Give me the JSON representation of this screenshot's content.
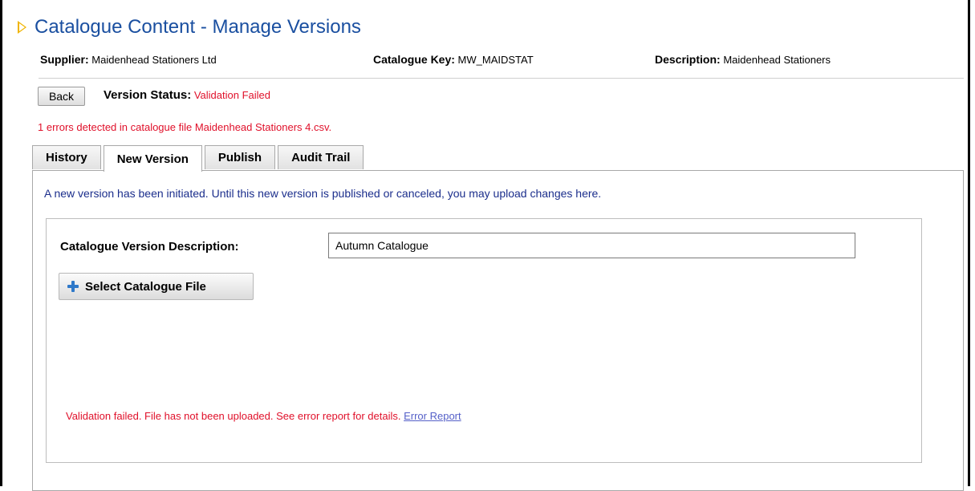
{
  "page": {
    "title": "Catalogue Content - Manage Versions"
  },
  "info": {
    "supplier_label": "Supplier:",
    "supplier_value": "Maidenhead Stationers Ltd",
    "key_label": "Catalogue Key:",
    "key_value": "MW_MAIDSTAT",
    "description_label": "Description:",
    "description_value": "Maidenhead Stationers"
  },
  "actions": {
    "back_label": "Back"
  },
  "status": {
    "label": "Version Status:",
    "value": "Validation Failed",
    "errors_message": "1 errors detected in catalogue file Maidenhead Stationers 4.csv."
  },
  "tabs": [
    {
      "label": "History",
      "active": false
    },
    {
      "label": "New Version",
      "active": true
    },
    {
      "label": "Publish",
      "active": false
    },
    {
      "label": "Audit Trail",
      "active": false
    }
  ],
  "panel": {
    "notice": "A new version has been initiated. Until this new version is published or canceled, you may upload changes here.",
    "version_description_label": "Catalogue Version Description:",
    "version_description_value": "Autumn Catalogue",
    "select_file_label": "Select Catalogue File",
    "failure_message": "Validation failed. File has not been uploaded. See error report for details.",
    "error_report_link": "Error Report"
  },
  "colors": {
    "title": "#1a4fa0",
    "error": "#e0102a",
    "notice": "#1b2e8c",
    "link": "#5560c8",
    "accent_arrow": "#f0b400"
  },
  "icons": {
    "title_marker": "triangle-right-icon",
    "select_file": "plus-icon"
  }
}
